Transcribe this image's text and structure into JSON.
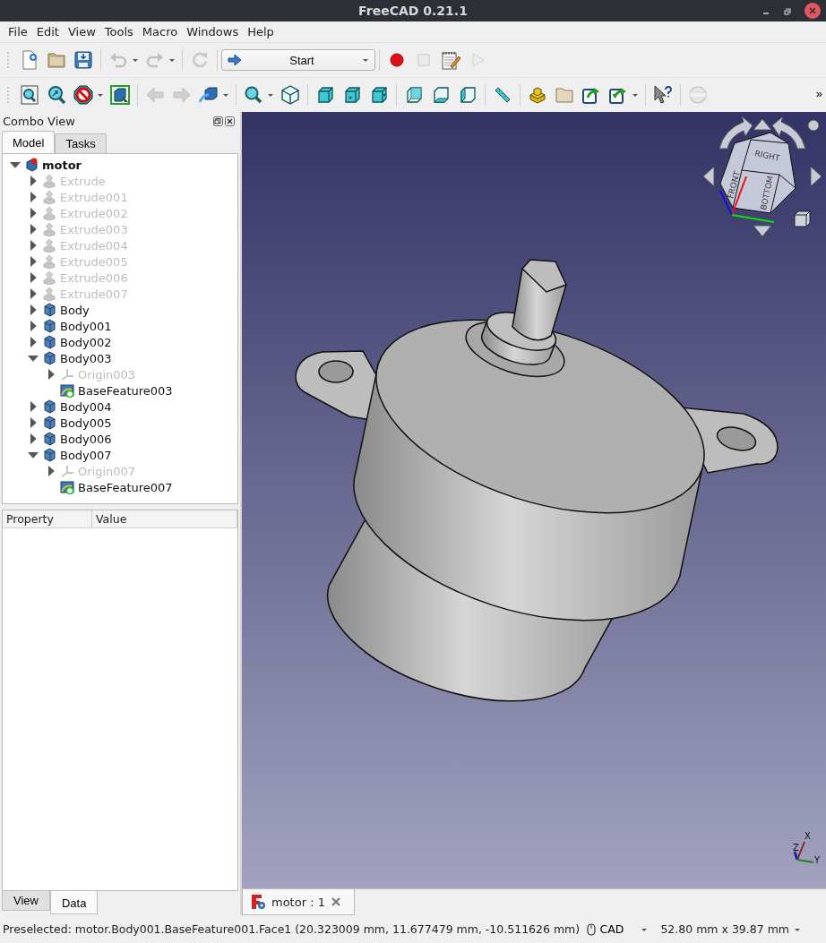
{
  "window": {
    "title": "FreeCAD 0.21.1"
  },
  "menu": [
    "File",
    "Edit",
    "View",
    "Tools",
    "Macro",
    "Windows",
    "Help"
  ],
  "toolbar_1": [
    {
      "kind": "new",
      "disabled": false,
      "dropdown": false
    },
    {
      "kind": "open",
      "disabled": false,
      "dropdown": false
    },
    {
      "kind": "save",
      "disabled": false,
      "dropdown": false
    },
    {
      "kind": "separator"
    },
    {
      "kind": "undo",
      "disabled": true,
      "dropdown": true
    },
    {
      "kind": "redo",
      "disabled": true,
      "dropdown": true
    },
    {
      "kind": "separator"
    },
    {
      "kind": "refresh",
      "disabled": true,
      "dropdown": false
    },
    {
      "kind": "separator"
    },
    {
      "kind": "workbench",
      "label": "Start"
    },
    {
      "kind": "separator"
    },
    {
      "kind": "record",
      "disabled": false,
      "dropdown": false
    },
    {
      "kind": "stop",
      "disabled": true,
      "dropdown": false
    },
    {
      "kind": "macro",
      "disabled": false,
      "dropdown": false
    },
    {
      "kind": "play",
      "disabled": true,
      "dropdown": false
    }
  ],
  "toolbar_2": [
    {
      "kind": "fit_all",
      "disabled": false,
      "dropdown": false
    },
    {
      "kind": "fit_selection",
      "disabled": false,
      "dropdown": false
    },
    {
      "kind": "draw_style",
      "disabled": false,
      "dropdown": true
    },
    {
      "kind": "bounding_box",
      "disabled": false,
      "dropdown": false
    },
    {
      "kind": "separator"
    },
    {
      "kind": "back",
      "disabled": true,
      "dropdown": false
    },
    {
      "kind": "forward",
      "disabled": true,
      "dropdown": false
    },
    {
      "kind": "sync",
      "disabled": false,
      "dropdown": true
    },
    {
      "kind": "separator"
    },
    {
      "kind": "zoom",
      "disabled": false,
      "dropdown": true
    },
    {
      "kind": "iso",
      "disabled": false,
      "dropdown": false
    },
    {
      "kind": "separator"
    },
    {
      "kind": "view_front",
      "disabled": false,
      "dropdown": false
    },
    {
      "kind": "view_top",
      "disabled": false,
      "dropdown": false
    },
    {
      "kind": "view_right",
      "disabled": false,
      "dropdown": false
    },
    {
      "kind": "separator"
    },
    {
      "kind": "view_rear",
      "disabled": false,
      "dropdown": false
    },
    {
      "kind": "view_bottom",
      "disabled": false,
      "dropdown": false
    },
    {
      "kind": "view_left",
      "disabled": false,
      "dropdown": false
    },
    {
      "kind": "separator"
    },
    {
      "kind": "measure",
      "disabled": false,
      "dropdown": false
    },
    {
      "kind": "separator"
    },
    {
      "kind": "part",
      "disabled": false,
      "dropdown": false
    },
    {
      "kind": "group",
      "disabled": false,
      "dropdown": false
    },
    {
      "kind": "link",
      "disabled": false,
      "dropdown": false
    },
    {
      "kind": "link_sub",
      "disabled": false,
      "dropdown": true
    },
    {
      "kind": "separator"
    },
    {
      "kind": "whats_this",
      "disabled": false,
      "dropdown": false
    },
    {
      "kind": "separator"
    },
    {
      "kind": "std_circle",
      "disabled": true,
      "dropdown": false
    }
  ],
  "toolbar_overflow": "»",
  "combo_view": {
    "title": "Combo View",
    "tabs": [
      {
        "label": "Model",
        "selected": true
      },
      {
        "label": "Tasks",
        "selected": false
      }
    ],
    "tree": [
      {
        "label": "motor",
        "kind": "document",
        "expandable": true,
        "expanded": true,
        "disabled": false,
        "children": [
          {
            "label": "Extrude",
            "kind": "extrude",
            "expandable": true,
            "expanded": false,
            "disabled": true
          },
          {
            "label": "Extrude001",
            "kind": "extrude",
            "expandable": true,
            "expanded": false,
            "disabled": true
          },
          {
            "label": "Extrude002",
            "kind": "extrude",
            "expandable": true,
            "expanded": false,
            "disabled": true
          },
          {
            "label": "Extrude003",
            "kind": "extrude",
            "expandable": true,
            "expanded": false,
            "disabled": true
          },
          {
            "label": "Extrude004",
            "kind": "extrude",
            "expandable": true,
            "expanded": false,
            "disabled": true
          },
          {
            "label": "Extrude005",
            "kind": "extrude",
            "expandable": true,
            "expanded": false,
            "disabled": true
          },
          {
            "label": "Extrude006",
            "kind": "extrude",
            "expandable": true,
            "expanded": false,
            "disabled": true
          },
          {
            "label": "Extrude007",
            "kind": "extrude",
            "expandable": true,
            "expanded": false,
            "disabled": true
          },
          {
            "label": "Body",
            "kind": "body",
            "expandable": true,
            "expanded": false,
            "disabled": false
          },
          {
            "label": "Body001",
            "kind": "body",
            "expandable": true,
            "expanded": false,
            "disabled": false
          },
          {
            "label": "Body002",
            "kind": "body",
            "expandable": true,
            "expanded": false,
            "disabled": false
          },
          {
            "label": "Body003",
            "kind": "body",
            "expandable": true,
            "expanded": true,
            "disabled": false,
            "children": [
              {
                "label": "Origin003",
                "kind": "origin",
                "expandable": true,
                "expanded": false,
                "disabled": true
              },
              {
                "label": "BaseFeature003",
                "kind": "feature",
                "expandable": false,
                "disabled": false
              }
            ]
          },
          {
            "label": "Body004",
            "kind": "body",
            "expandable": true,
            "expanded": false,
            "disabled": false
          },
          {
            "label": "Body005",
            "kind": "body",
            "expandable": true,
            "expanded": false,
            "disabled": false
          },
          {
            "label": "Body006",
            "kind": "body",
            "expandable": true,
            "expanded": false,
            "disabled": false
          },
          {
            "label": "Body007",
            "kind": "body",
            "expandable": true,
            "expanded": true,
            "disabled": false,
            "children": [
              {
                "label": "Origin007",
                "kind": "origin",
                "expandable": true,
                "expanded": false,
                "disabled": true
              },
              {
                "label": "BaseFeature007",
                "kind": "feature",
                "expandable": false,
                "disabled": false
              }
            ]
          }
        ]
      }
    ],
    "property_columns": [
      "Property",
      "Value"
    ],
    "bottom_tabs": [
      {
        "label": "View",
        "selected": false
      },
      {
        "label": "Data",
        "selected": true
      }
    ]
  },
  "viewport": {
    "nav_cube": {
      "faces": [
        "RIGHT",
        "FRONT",
        "BOTTOM"
      ]
    },
    "axis_labels": [
      "X",
      "Z",
      "Y"
    ]
  },
  "document_tabs": [
    {
      "label": "motor : 1",
      "selected": true
    }
  ],
  "status_bar": {
    "message": "Preselected: motor.Body001.BaseFeature001.Face1 (20.323009 mm, 11.677479 mm, -10.511626 mm)",
    "navigation": "CAD",
    "dimensions": "52.80 mm x 39.87 mm"
  }
}
